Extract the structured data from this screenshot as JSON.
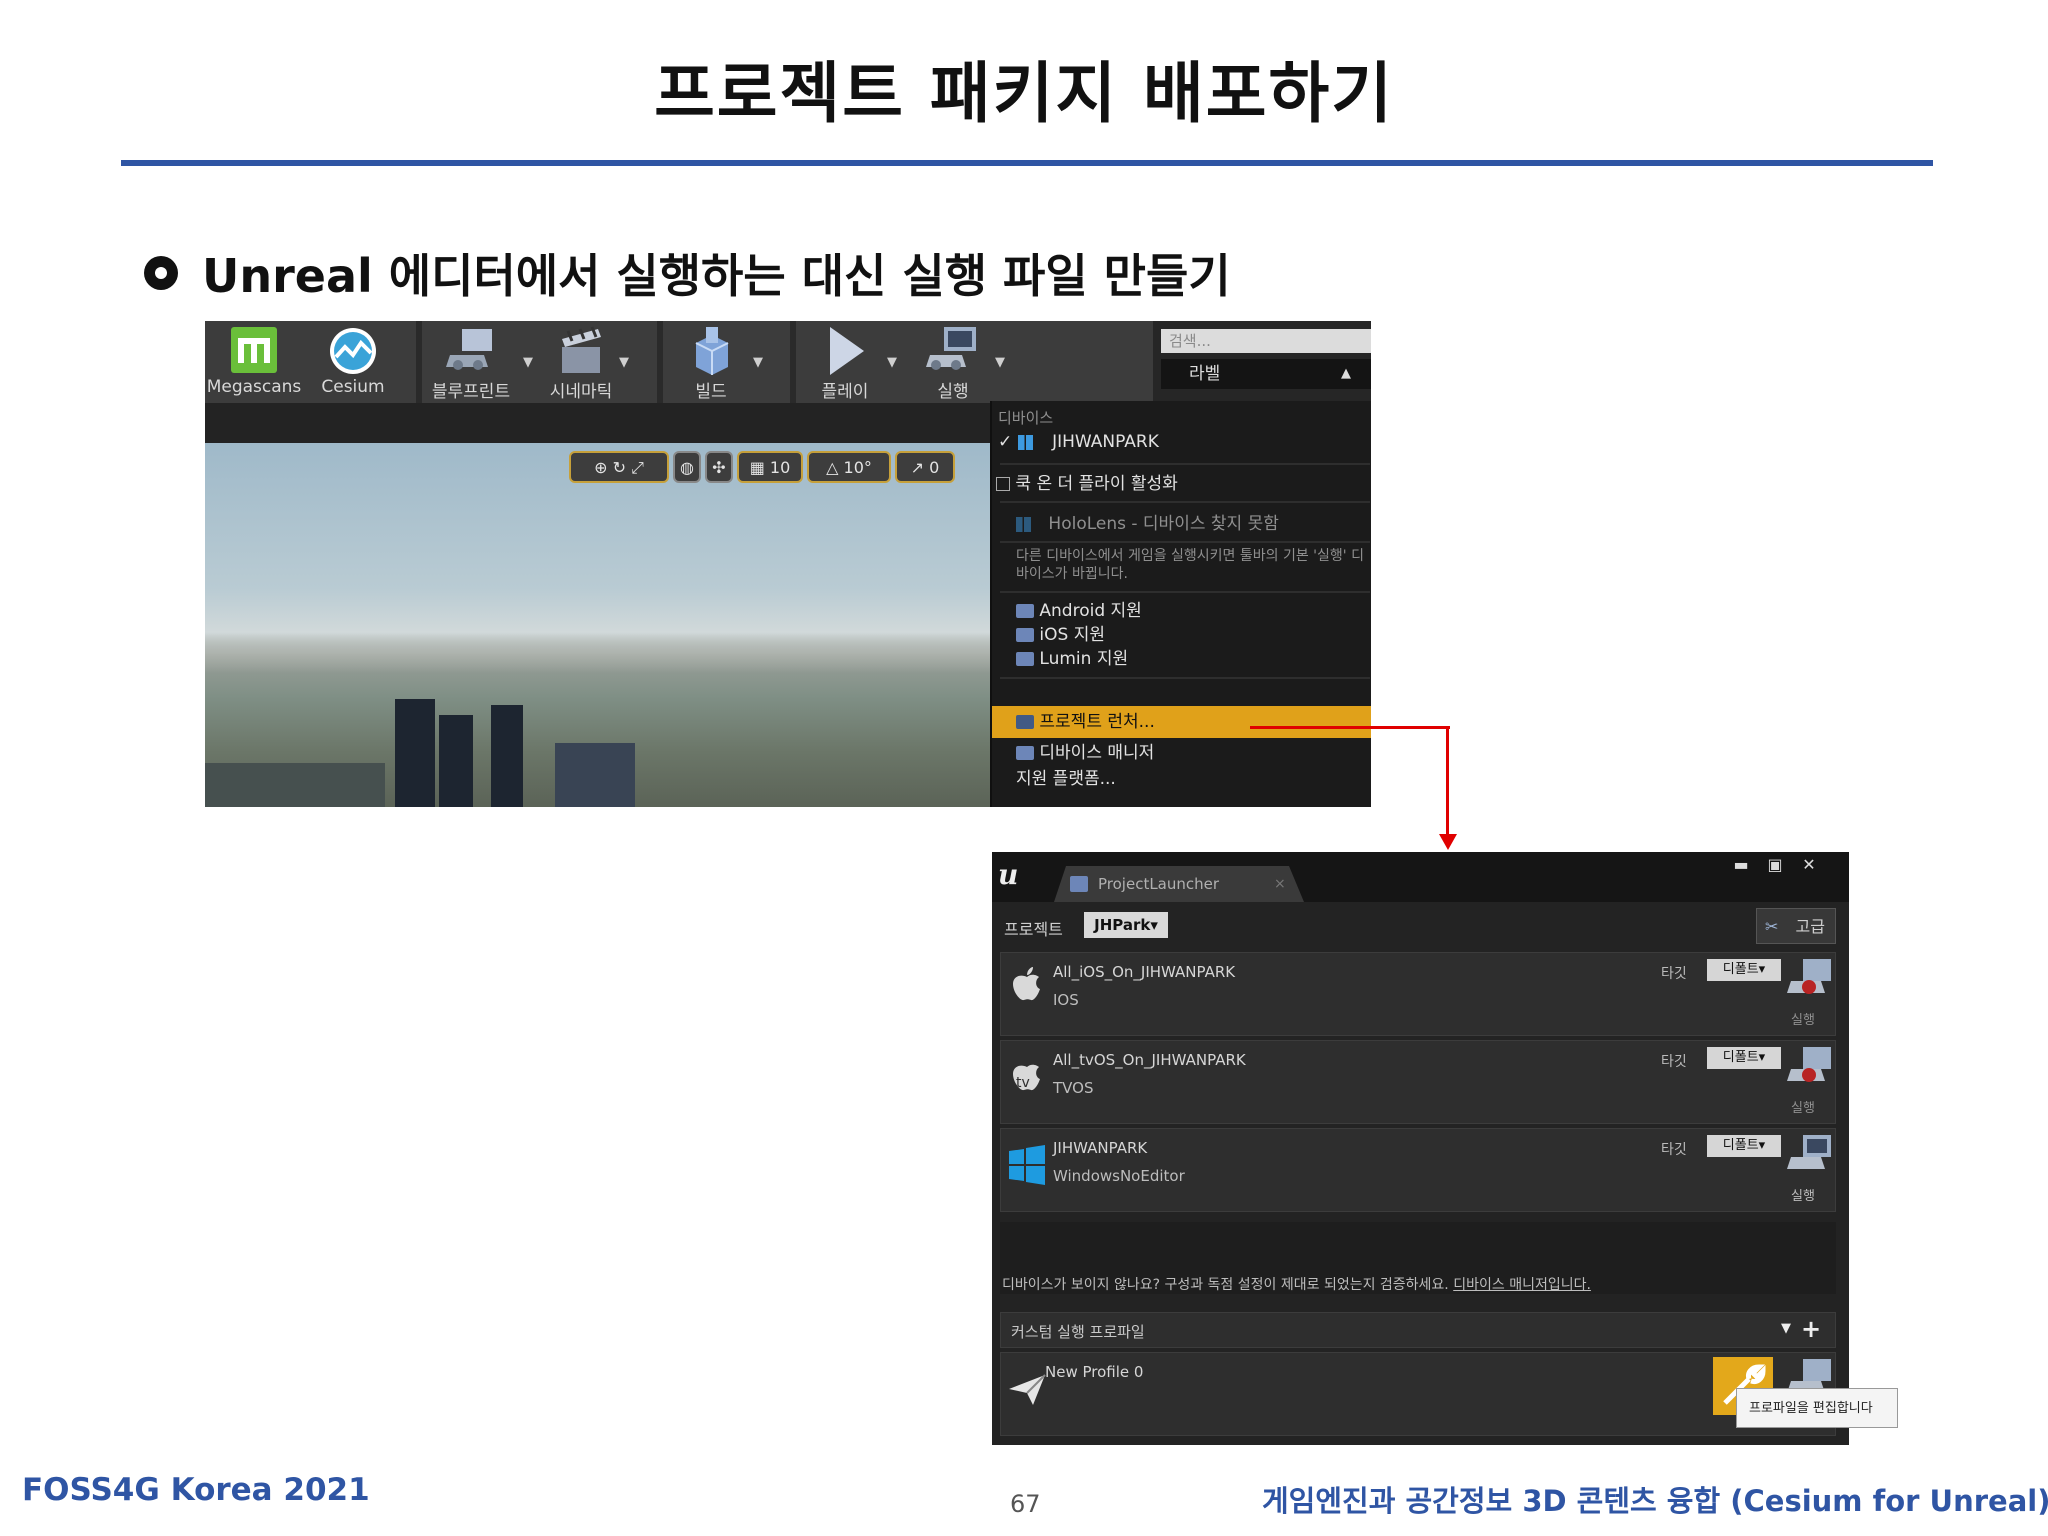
{
  "slide": {
    "title": "프로젝트 패키지 배포하기",
    "bullet": "Unreal 에디터에서 실행하는 대신 실행 파일 만들기",
    "footer_left": "FOSS4G Korea 2021",
    "page_number": "67",
    "footer_right": "게임엔진과 공간정보 3D 콘텐츠 융합 (Cesium for Unreal)",
    "accent_color": "#2f55a4"
  },
  "editor": {
    "toolbar": [
      {
        "label": "Megascans",
        "icon": "megascans-icon"
      },
      {
        "label": "Cesium",
        "icon": "cesium-icon"
      },
      {
        "label": "블루프린트",
        "icon": "blueprint-icon"
      },
      {
        "label": "시네마틱",
        "icon": "cinematics-icon"
      },
      {
        "label": "빌드",
        "icon": "build-icon"
      },
      {
        "label": "플레이",
        "icon": "play-icon"
      },
      {
        "label": "실행",
        "icon": "launch-icon"
      }
    ],
    "search_placeholder": "검색...",
    "label_header": "라벨",
    "viewport_tools": {
      "grid_snap": "10",
      "rotation_snap": "10°",
      "scale_snap": "0"
    },
    "menu": {
      "section_devices": "디바이스",
      "device_checked": "JIHWANPARK",
      "cook_on_fly": "쿡 온 더 플라이 활성화",
      "hololens": "HoloLens - 디바이스 찾지 못함",
      "note": "다른 디바이스에서 게임을 실행시키면 툴바의 기본 '실행' 디바이스가 바뀝니다.",
      "android": "Android 지원",
      "ios": "iOS 지원",
      "lumin": "Lumin 지원",
      "project_launcher": "프로젝트 런처...",
      "device_manager": "디바이스 매니저",
      "supported_platforms": "지원 플랫폼..."
    }
  },
  "launcher": {
    "tab_title": "ProjectLauncher",
    "project_label": "프로젝트",
    "project_value": "JHPark▾",
    "advanced_label": "고급",
    "target_label": "타깃",
    "default_label": "디폴트▾",
    "launch_label": "실행",
    "rows": [
      {
        "name": "All_iOS_On_JIHWANPARK",
        "platform": "IOS",
        "icon": "apple-icon"
      },
      {
        "name": "All_tvOS_On_JIHWANPARK",
        "platform": "TVOS",
        "icon": "apple-tv-icon"
      },
      {
        "name": "JIHWANPARK",
        "platform": "WindowsNoEditor",
        "icon": "windows-icon"
      }
    ],
    "hint_text": "디바이스가 보이지 않나요? 구성과 독점 설정이 제대로 되었는지 검증하세요.",
    "hint_link": "디바이스 매니저입니다.",
    "custom_profiles_label": "커스텀 실행 프로파일",
    "profile_name": "New Profile 0",
    "edit_tooltip": "프로파일을 편집합니다"
  }
}
